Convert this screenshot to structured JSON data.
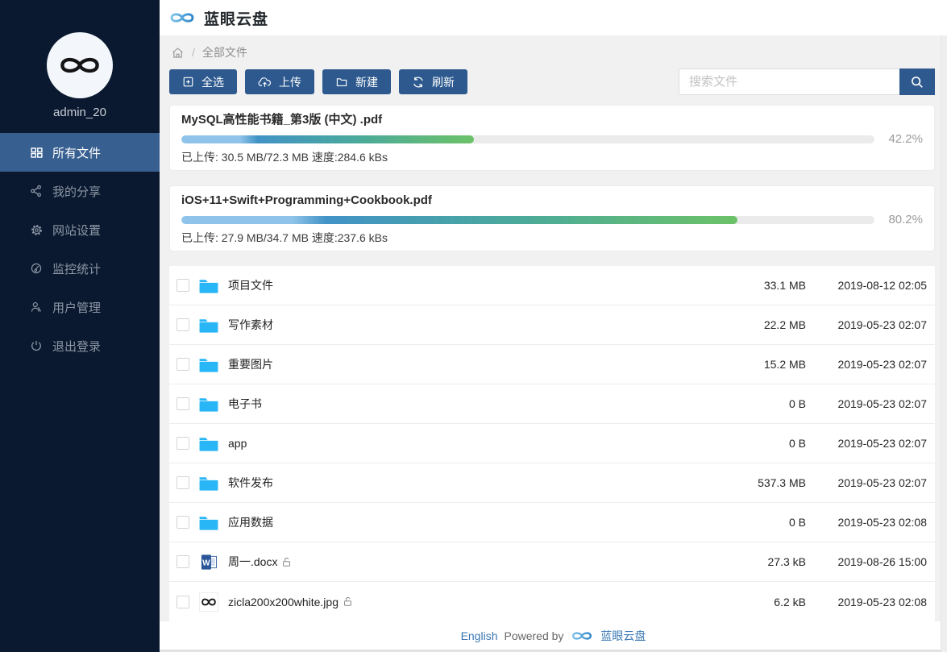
{
  "header": {
    "app_title": "蓝眼云盘"
  },
  "sidebar": {
    "username": "admin_20",
    "items": [
      {
        "id": "all-files",
        "label": "所有文件",
        "icon": "grid-icon",
        "active": true
      },
      {
        "id": "my-shares",
        "label": "我的分享",
        "icon": "share-icon",
        "active": false
      },
      {
        "id": "site-settings",
        "label": "网站设置",
        "icon": "gear-icon",
        "active": false
      },
      {
        "id": "monitor-stats",
        "label": "监控统计",
        "icon": "gauge-icon",
        "active": false
      },
      {
        "id": "user-management",
        "label": "用户管理",
        "icon": "user-icon",
        "active": false
      },
      {
        "id": "logout",
        "label": "退出登录",
        "icon": "power-icon",
        "active": false
      }
    ]
  },
  "breadcrumb": {
    "separator": "/",
    "current": "全部文件"
  },
  "toolbar": {
    "select_all": "全选",
    "upload": "上传",
    "new": "新建",
    "refresh": "刷新",
    "search_placeholder": "搜索文件"
  },
  "uploads": [
    {
      "filename": "MySQL高性能书籍_第3版 (中文) .pdf",
      "percent": "42.2%",
      "percent_value": 42.2,
      "status": "已上传: 30.5 MB/72.3 MB 速度:284.6 kBs"
    },
    {
      "filename": "iOS+11+Swift+Programming+Cookbook.pdf",
      "percent": "80.2%",
      "percent_value": 80.2,
      "status": "已上传: 27.9 MB/34.7 MB 速度:237.6 kBs"
    }
  ],
  "files": [
    {
      "name": "项目文件",
      "icon": "folder-icon",
      "size": "33.1 MB",
      "date": "2019-08-12 02:05",
      "privacy": ""
    },
    {
      "name": "写作素材",
      "icon": "folder-icon",
      "size": "22.2 MB",
      "date": "2019-05-23 02:07",
      "privacy": ""
    },
    {
      "name": "重要图片",
      "icon": "folder-icon",
      "size": "15.2 MB",
      "date": "2019-05-23 02:07",
      "privacy": ""
    },
    {
      "name": "电子书",
      "icon": "folder-icon",
      "size": "0 B",
      "date": "2019-05-23 02:07",
      "privacy": ""
    },
    {
      "name": "app",
      "icon": "folder-icon",
      "size": "0 B",
      "date": "2019-05-23 02:07",
      "privacy": ""
    },
    {
      "name": "软件发布",
      "icon": "folder-icon",
      "size": "537.3 MB",
      "date": "2019-05-23 02:07",
      "privacy": ""
    },
    {
      "name": "应用数据",
      "icon": "folder-icon",
      "size": "0 B",
      "date": "2019-05-23 02:08",
      "privacy": ""
    },
    {
      "name": "周一.docx",
      "icon": "word-doc-icon",
      "size": "27.3 kB",
      "date": "2019-08-26 15:00",
      "privacy": "unlocked"
    },
    {
      "name": "zicla200x200white.jpg",
      "icon": "image-thumb-icon",
      "size": "6.2 kB",
      "date": "2019-05-23 02:08",
      "privacy": "unlocked"
    }
  ],
  "footer": {
    "language": "English",
    "powered_by": "Powered by",
    "brand": "蓝眼云盘"
  },
  "colors": {
    "sidebar_bg": "#0a1930",
    "sidebar_active": "#375f90",
    "button_blue": "#2d598e",
    "folder_blue": "#29b6f6",
    "link_blue": "#3b78b5",
    "progress_start": "#8fc3ea",
    "progress_mid": "#4aa99b",
    "progress_end": "#6cc268",
    "content_bg": "#f1f1f1"
  }
}
